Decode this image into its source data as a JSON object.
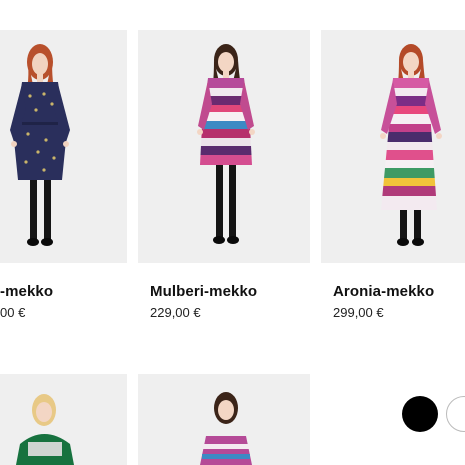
{
  "products": [
    {
      "name": "-mekko",
      "price": "00 €"
    },
    {
      "name": "Mulberi-mekko",
      "price": "229,00 €"
    },
    {
      "name": "Aronia-mekko",
      "price": "299,00 €"
    }
  ],
  "swatches": [
    {
      "label": "black",
      "color": "#000000"
    },
    {
      "label": "white",
      "color": "#ffffff"
    }
  ],
  "colors": {
    "page_bg": "#ffffff",
    "photo_bg": "#efefef",
    "text": "#111111"
  }
}
